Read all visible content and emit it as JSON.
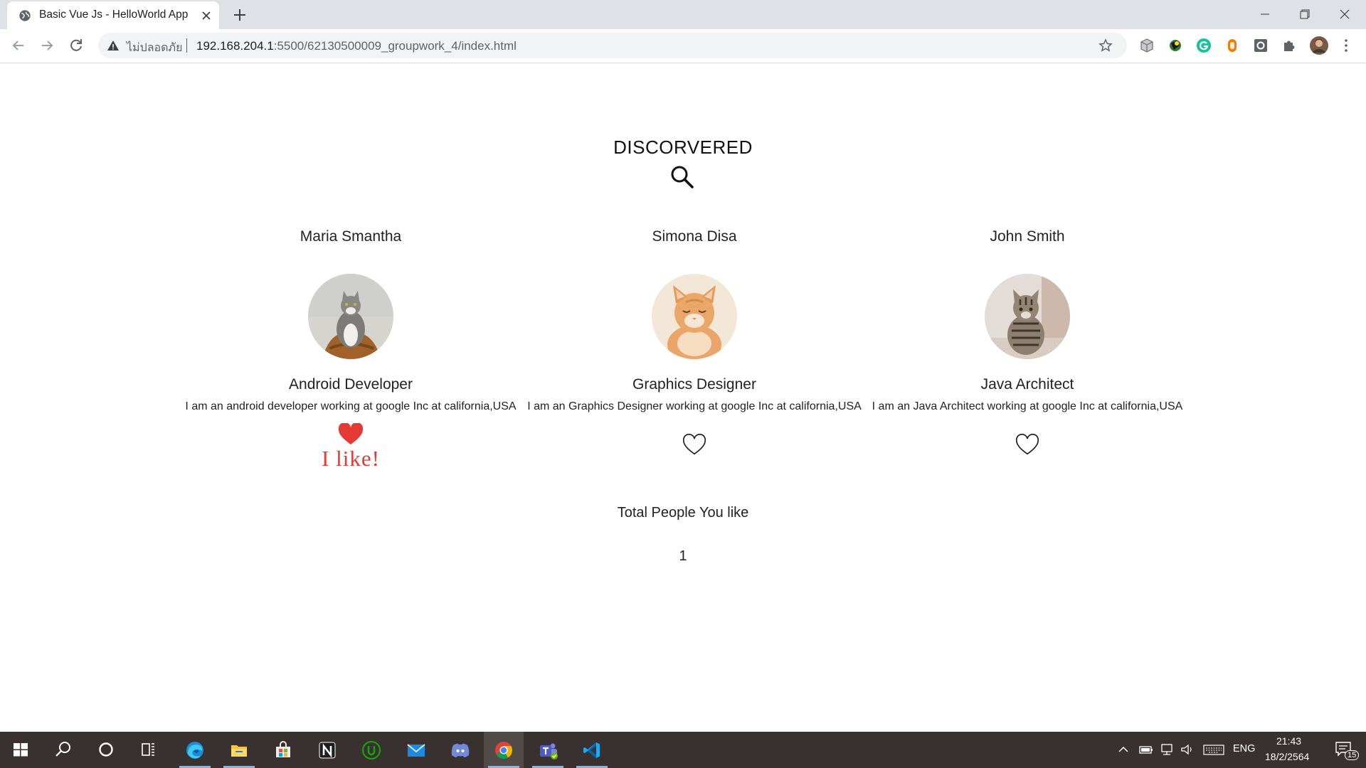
{
  "browser": {
    "tab_title": "Basic Vue Js - HelloWorld App",
    "security_label": "ไม่ปลอดภัย",
    "url_host": "192.168.204.1",
    "url_path": ":5500/62130500009_groupwork_4/index.html"
  },
  "page": {
    "heading": "DISCORVERED",
    "people": [
      {
        "name": "Maria Smantha",
        "role": "Android Developer",
        "description": "I am an android developer working at google Inc at california,USA",
        "liked": true,
        "like_text": "I  like!"
      },
      {
        "name": "Simona Disa",
        "role": "Graphics Designer",
        "description": "I am an Graphics Designer working at google Inc at california,USA",
        "liked": false
      },
      {
        "name": "John Smith",
        "role": "Java Architect",
        "description": "I am an Java Architect working at google Inc at california,USA",
        "liked": false
      }
    ],
    "total_label": "Total People You like",
    "total_count": "1"
  },
  "taskbar": {
    "apps": [
      "start-icon",
      "search-icon",
      "cortana-icon",
      "task-view-icon",
      "edge-icon",
      "file-explorer-icon",
      "store-icon",
      "notion-icon",
      "upwork-icon",
      "mail-icon",
      "discord-icon",
      "chrome-icon",
      "teams-icon",
      "vscode-icon"
    ],
    "language": "ENG",
    "time": "21:43",
    "date": "18/2/2564",
    "notification_count": "15"
  },
  "colors": {
    "heart_liked": "#e53935",
    "taskbar": "#38312f",
    "tabstrip": "#dee1e6"
  }
}
